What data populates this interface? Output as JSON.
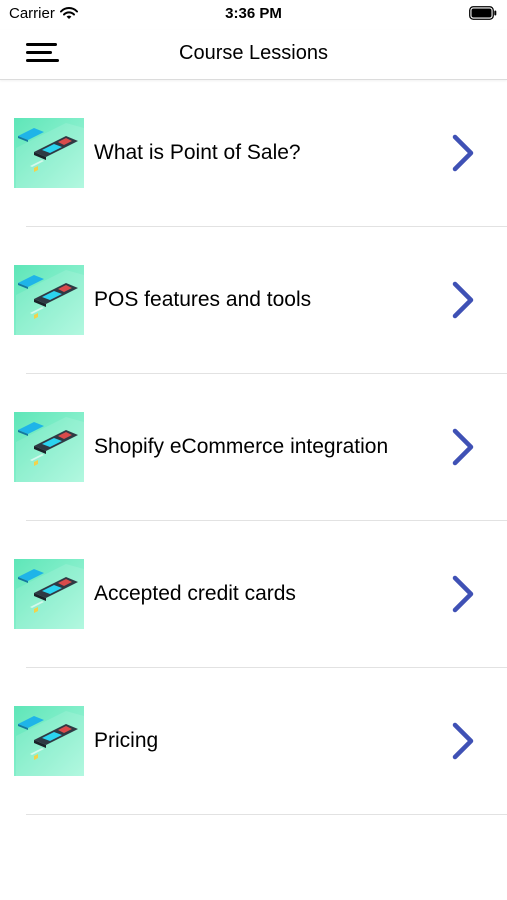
{
  "status_bar": {
    "carrier": "Carrier",
    "time": "3:36 PM",
    "wifi_icon": "wifi-icon",
    "battery_icon": "battery-icon"
  },
  "nav": {
    "title": "Course Lessions",
    "menu_icon": "hamburger-menu-icon"
  },
  "lessons": [
    {
      "title": "What is Point of Sale?",
      "thumbnail": "pos-terminal-image",
      "chevron": "chevron-right-icon"
    },
    {
      "title": "POS features and tools",
      "thumbnail": "pos-terminal-image",
      "chevron": "chevron-right-icon"
    },
    {
      "title": "Shopify eCommerce integration",
      "thumbnail": "pos-terminal-image",
      "chevron": "chevron-right-icon"
    },
    {
      "title": "Accepted credit cards",
      "thumbnail": "pos-terminal-image",
      "chevron": "chevron-right-icon"
    },
    {
      "title": "Pricing",
      "thumbnail": "pos-terminal-image",
      "chevron": "chevron-right-icon"
    }
  ],
  "colors": {
    "accent": "#3f51b5",
    "thumb_bg": "#7eefc4",
    "divider": "#e2e2e2"
  }
}
